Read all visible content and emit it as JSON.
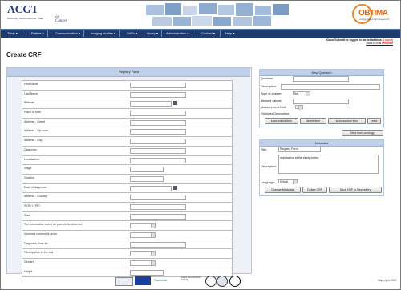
{
  "header": {
    "acgt_logo": "ACGT",
    "acgt_sub": "Advancing Clinico Genomic Trials",
    "on_cancer": "on Cancer",
    "obtima_logo": "OBTIMA",
    "obtima_tag": "ontology-based trial management"
  },
  "nav": {
    "items": [
      {
        "label": "Trials ▾"
      },
      {
        "label": "Patient ▾"
      },
      {
        "label": "Communication ▾"
      },
      {
        "label": "Imaging studies ▾"
      },
      {
        "label": "SAEs ▾"
      },
      {
        "label": "Query ▾"
      },
      {
        "label": "Administration ▾"
      },
      {
        "label": "Contact ▾"
      },
      {
        "label": "Help ▾"
      }
    ]
  },
  "login": {
    "prefix": "Klaus Schmitt is logged in as ",
    "user": "testobtima",
    "logout": "(Logout)",
    "back": "Back to trial template"
  },
  "page_title": "Create CRF",
  "registry": {
    "heading": "Registry Form",
    "fields": [
      {
        "label": "First Name",
        "type": "text"
      },
      {
        "label": "Last Name",
        "type": "text"
      },
      {
        "label": "Birthday",
        "type": "date"
      },
      {
        "label": "Place of birth",
        "type": "text"
      },
      {
        "label": "Address - Street",
        "type": "text"
      },
      {
        "label": "Address - Zip code",
        "type": "text"
      },
      {
        "label": "Address - City",
        "type": "text"
      },
      {
        "label": "Diagnosis",
        "type": "text"
      },
      {
        "label": "Localisation",
        "type": "text"
      },
      {
        "label": "Stage",
        "type": "short"
      },
      {
        "label": "Grading",
        "type": "short"
      },
      {
        "label": "Date of diagnosis",
        "type": "date"
      },
      {
        "label": "Address - Country",
        "type": "text"
      },
      {
        "label": "SIOP-I / PID",
        "type": "text"
      },
      {
        "label": "Side",
        "type": "text"
      },
      {
        "label": "The information sheet for parents is delivered",
        "type": "select"
      },
      {
        "label": "Informed consent is given",
        "type": "select"
      },
      {
        "label": "Diagnosis done by",
        "type": "text"
      },
      {
        "label": "Participation in the trial",
        "type": "select"
      },
      {
        "label": "Gender",
        "type": "select"
      },
      {
        "label": "Height",
        "type": "short"
      }
    ]
  },
  "new_question": {
    "heading": "New Question",
    "question_label": "Question:",
    "description_label": "Description:",
    "type_label": "Type of answer:",
    "type_value": "text",
    "allowed_label": "Allowed values:",
    "unit_label": "Measurement Unit:",
    "ontology_label": "Ontology Description:",
    "buttons": {
      "save_edited": "save edited item",
      "delete": "delete item",
      "save_new": "save as new item",
      "reset": "reset"
    },
    "new_from_ontology": "New from ontology"
  },
  "metadata": {
    "heading": "Metadata",
    "title_label": "Title:",
    "title_value": "Registry Form",
    "description_label": "Description:",
    "description_value": "registration at the study centre",
    "language_label": "Language:",
    "language_value": "Default",
    "buttons": {
      "change": "Change Metadata",
      "delete": "Delete CRF",
      "save_repo": "Save CRF to Repository"
    }
  },
  "footer": {
    "copyright": "Copyright 2008",
    "logo_fraunhofer": "Fraunhofer",
    "logo_institut": "Institut Biomedizinische Technik"
  }
}
